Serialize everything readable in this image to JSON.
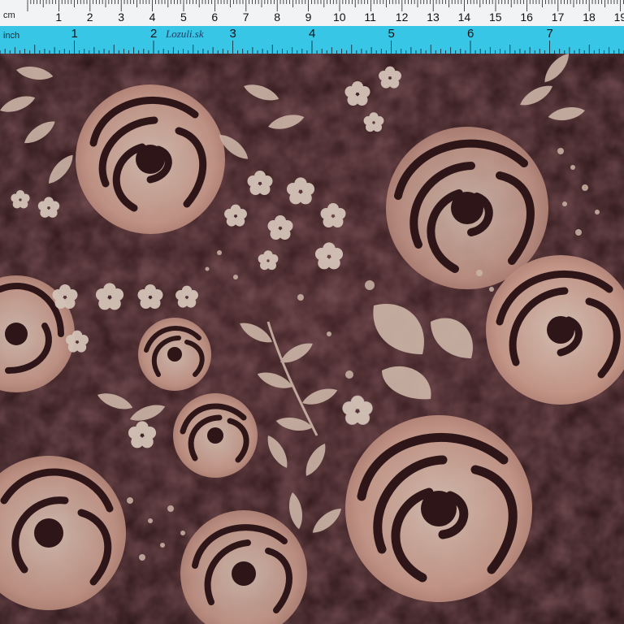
{
  "ruler": {
    "cm_unit": "cm",
    "inch_unit": "inch",
    "brand": "Lozuli.sk",
    "cm_labels": [
      "1",
      "2",
      "3",
      "4",
      "5",
      "6",
      "7",
      "8",
      "9",
      "10",
      "11",
      "12",
      "13",
      "14",
      "15",
      "16",
      "17",
      "18",
      "19",
      "2"
    ],
    "inch_labels": [
      "1",
      "2",
      "3",
      "4",
      "5",
      "6",
      "7"
    ]
  },
  "colors": {
    "fabric_base": "#2e1618",
    "petal_light": "#cbb4a6",
    "petal_pink": "#c08e80",
    "ruler_cyan": "#37c6e6",
    "ruler_white": "#f1f3f4"
  }
}
